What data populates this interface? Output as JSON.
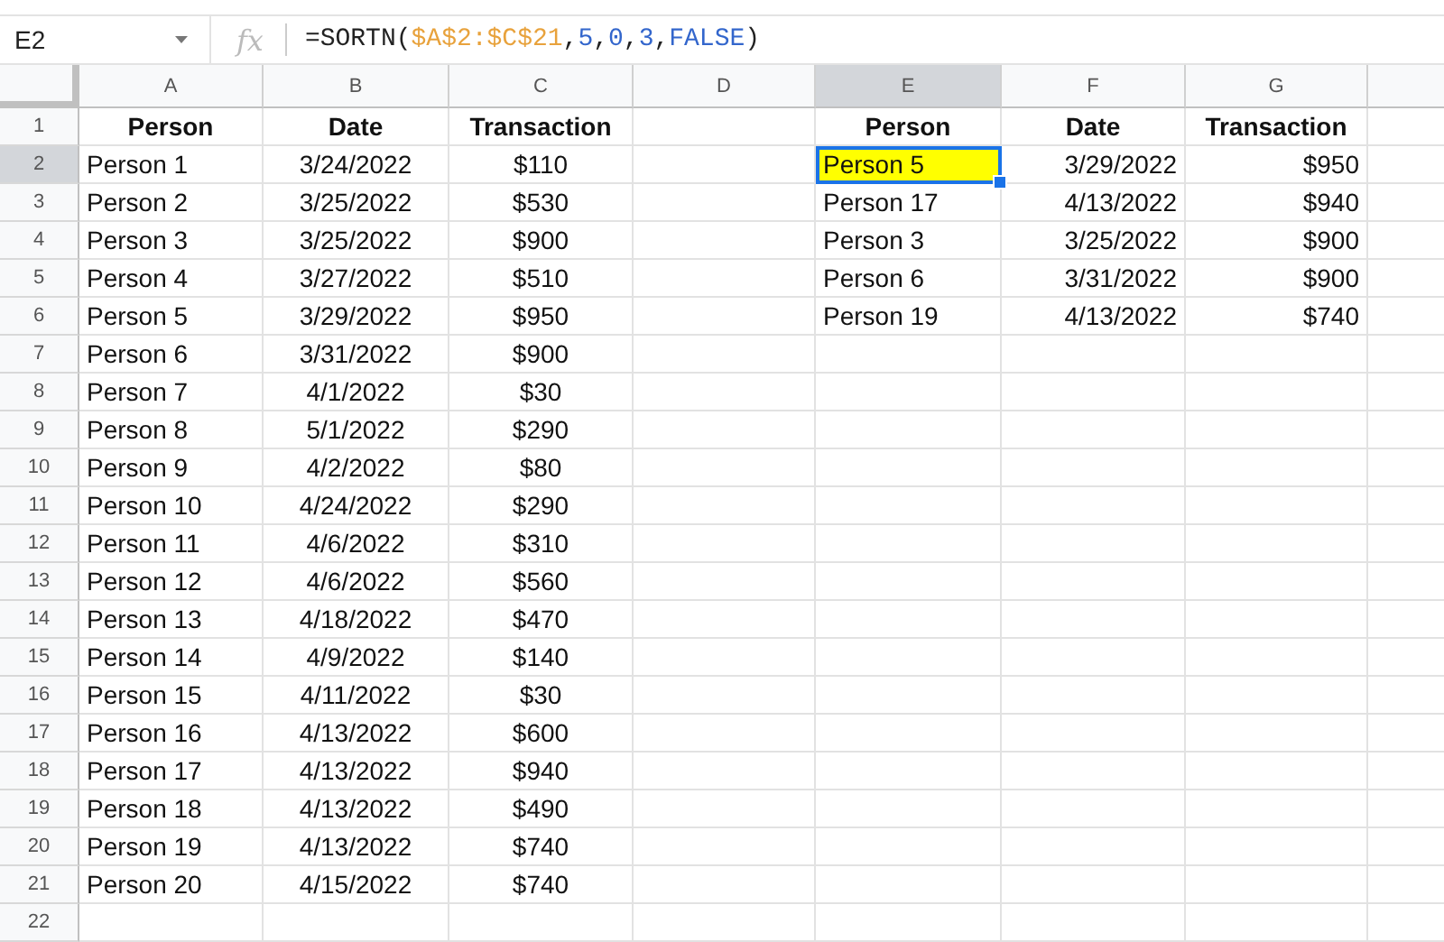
{
  "formula_bar": {
    "name_box": "E2",
    "fx_label": "fx",
    "formula": [
      {
        "text": "=SORTN(",
        "kind": "plain"
      },
      {
        "text": "$A$2:$C$21",
        "kind": "range"
      },
      {
        "text": ",",
        "kind": "plain"
      },
      {
        "text": "5",
        "kind": "number"
      },
      {
        "text": ",",
        "kind": "plain"
      },
      {
        "text": "0",
        "kind": "number"
      },
      {
        "text": ",",
        "kind": "plain"
      },
      {
        "text": "3",
        "kind": "number"
      },
      {
        "text": ",",
        "kind": "plain"
      },
      {
        "text": "FALSE",
        "kind": "number"
      },
      {
        "text": ")",
        "kind": "plain"
      }
    ]
  },
  "columns": [
    {
      "label": "A",
      "selected": false
    },
    {
      "label": "B",
      "selected": false
    },
    {
      "label": "C",
      "selected": false
    },
    {
      "label": "D",
      "selected": false
    },
    {
      "label": "E",
      "selected": true
    },
    {
      "label": "F",
      "selected": false
    },
    {
      "label": "G",
      "selected": false
    },
    {
      "selected": false
    }
  ],
  "rows": [
    {
      "number": "1",
      "selected": false,
      "cells": [
        "Person",
        "Date",
        "Transaction",
        null,
        "Person",
        "Date",
        "Transaction"
      ]
    },
    {
      "number": "2",
      "selected": true,
      "cells": [
        "Person 1",
        "3/24/2022",
        "$110",
        null,
        {
          "text": "Person 5",
          "selected": true,
          "color": "#ffff00"
        },
        "3/29/2022",
        "$950"
      ]
    },
    {
      "number": "3",
      "selected": false,
      "cells": [
        "Person 2",
        "3/25/2022",
        "$530",
        null,
        "Person 17",
        "4/13/2022",
        "$940"
      ]
    },
    {
      "number": "4",
      "selected": false,
      "cells": [
        "Person 3",
        "3/25/2022",
        "$900",
        null,
        "Person 3",
        "3/25/2022",
        "$900"
      ]
    },
    {
      "number": "5",
      "selected": false,
      "cells": [
        "Person 4",
        "3/27/2022",
        "$510",
        null,
        "Person 6",
        "3/31/2022",
        "$900"
      ]
    },
    {
      "number": "6",
      "selected": false,
      "cells": [
        "Person 5",
        "3/29/2022",
        "$950",
        null,
        "Person 19",
        "4/13/2022",
        "$740"
      ]
    },
    {
      "number": "7",
      "selected": false,
      "cells": [
        "Person 6",
        "3/31/2022",
        "$900"
      ]
    },
    {
      "number": "8",
      "selected": false,
      "cells": [
        "Person 7",
        "4/1/2022",
        "$30"
      ]
    },
    {
      "number": "9",
      "selected": false,
      "cells": [
        "Person 8",
        "5/1/2022",
        "$290"
      ]
    },
    {
      "number": "10",
      "selected": false,
      "cells": [
        "Person 9",
        "4/2/2022",
        "$80"
      ]
    },
    {
      "number": "11",
      "selected": false,
      "cells": [
        "Person 10",
        "4/24/2022",
        "$290"
      ]
    },
    {
      "number": "12",
      "selected": false,
      "cells": [
        "Person 11",
        "4/6/2022",
        "$310"
      ]
    },
    {
      "number": "13",
      "selected": false,
      "cells": [
        "Person 12",
        "4/6/2022",
        "$560"
      ]
    },
    {
      "number": "14",
      "selected": false,
      "cells": [
        "Person 13",
        "4/18/2022",
        "$470"
      ]
    },
    {
      "number": "15",
      "selected": false,
      "cells": [
        "Person 14",
        "4/9/2022",
        "$140"
      ]
    },
    {
      "number": "16",
      "selected": false,
      "cells": [
        "Person 15",
        "4/11/2022",
        "$30"
      ]
    },
    {
      "number": "17",
      "selected": false,
      "cells": [
        "Person 16",
        "4/13/2022",
        "$600"
      ]
    },
    {
      "number": "18",
      "selected": false,
      "cells": [
        "Person 17",
        "4/13/2022",
        "$940"
      ]
    },
    {
      "number": "19",
      "selected": false,
      "cells": [
        "Person 18",
        "4/13/2022",
        "$490"
      ]
    },
    {
      "number": "20",
      "selected": false,
      "cells": [
        "Person 19",
        "4/13/2022",
        "$740"
      ]
    },
    {
      "number": "21",
      "selected": false,
      "cells": [
        "Person 20",
        "4/15/2022",
        "$740"
      ]
    },
    {
      "number": "22",
      "selected": false,
      "cells": []
    }
  ]
}
